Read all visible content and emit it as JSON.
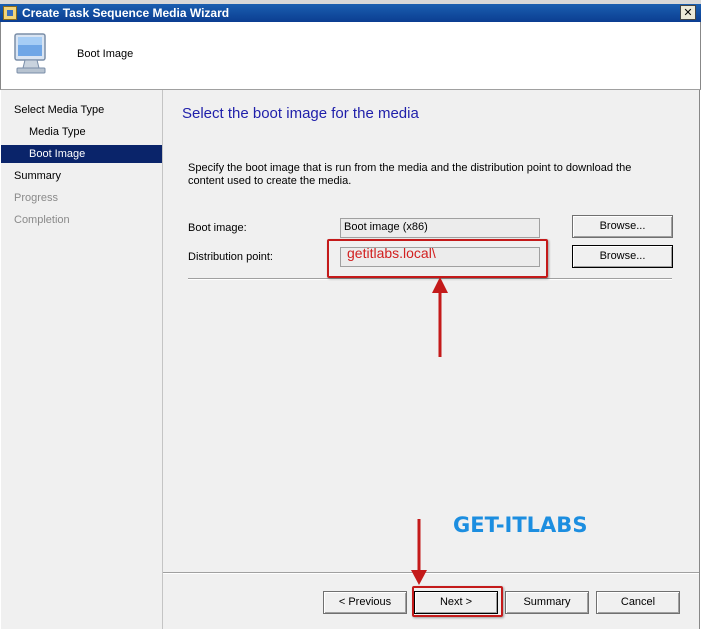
{
  "window": {
    "title": "Create Task Sequence Media Wizard",
    "close_glyph": "✕"
  },
  "header": {
    "icon": "computer-monitor-icon",
    "title": "Boot Image"
  },
  "sidebar": {
    "items": [
      {
        "label": "Select Media Type",
        "state": "normal"
      },
      {
        "label": "Media Type",
        "state": "normal"
      },
      {
        "label": "Boot Image",
        "state": "selected"
      },
      {
        "label": "Summary",
        "state": "normal"
      },
      {
        "label": "Progress",
        "state": "disabled"
      },
      {
        "label": "Completion",
        "state": "disabled"
      }
    ]
  },
  "main": {
    "heading": "Select the boot image for the media",
    "description": "Specify the boot image that is run from the media and the distribution point to download the content used to create the media.",
    "boot_image": {
      "label": "Boot image:",
      "value": "Boot image (x86)",
      "browse_label": "Browse..."
    },
    "distribution_point": {
      "label": "Distribution point:",
      "value": "getitlabs.local\\",
      "browse_label": "Browse..."
    }
  },
  "footer": {
    "previous_label": "< Previous",
    "next_label": "Next >",
    "summary_label": "Summary",
    "cancel_label": "Cancel"
  },
  "annotations": {
    "watermark": "GET-ITLABS",
    "accent_color": "#c41a1a",
    "watermark_color": "#1c8ee0"
  },
  "colors": {
    "titlebar": "#0b3d91",
    "selection": "#0a246a",
    "heading": "#1f1faa",
    "panel": "#f0f0f0"
  }
}
